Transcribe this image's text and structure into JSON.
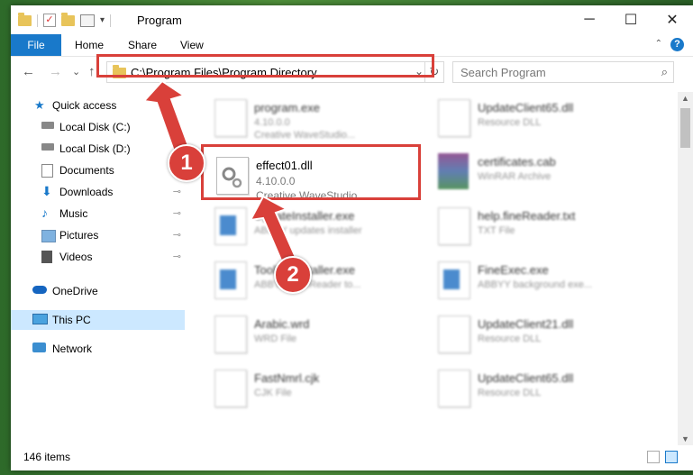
{
  "window": {
    "title": "Program",
    "minimize_glyph": "─",
    "maximize_glyph": "☐",
    "close_glyph": "✕"
  },
  "ribbon": {
    "tabs": [
      "File",
      "Home",
      "Share",
      "View"
    ],
    "help_glyph": "?",
    "collapse_glyph": "⌃"
  },
  "navigation": {
    "back_glyph": "←",
    "forward_glyph": "→",
    "recent_glyph": "⌄",
    "up_glyph": "↑",
    "address": "C:\\Program Files\\Program Directory",
    "dropdown_glyph": "⌄",
    "refresh_glyph": "↻",
    "search_placeholder": "Search Program",
    "search_glyph": "⌕"
  },
  "sidebar": {
    "items": [
      {
        "label": "Quick access",
        "icon": "star-icon"
      },
      {
        "label": "Local Disk (C:)",
        "icon": "drive-icon"
      },
      {
        "label": "Local Disk (D:)",
        "icon": "drive-icon"
      },
      {
        "label": "Documents",
        "icon": "documents-icon"
      },
      {
        "label": "Downloads",
        "icon": "download-icon",
        "pinned": true
      },
      {
        "label": "Music",
        "icon": "music-icon",
        "pinned": true
      },
      {
        "label": "Pictures",
        "icon": "pictures-icon",
        "pinned": true
      },
      {
        "label": "Videos",
        "icon": "videos-icon",
        "pinned": true
      },
      {
        "label": "OneDrive",
        "icon": "cloud-icon"
      },
      {
        "label": "This PC",
        "icon": "computer-icon",
        "selected": true
      },
      {
        "label": "Network",
        "icon": "network-icon"
      }
    ],
    "pin_glyph": "📌"
  },
  "files": [
    {
      "name": "program.exe",
      "line1": "4.10.0.0",
      "line2": "Creative WaveStudio...",
      "blurred": true
    },
    {
      "name": "UpdateClient65.dll",
      "line1": "Resource DLL",
      "blurred": true
    },
    {
      "name": "effect01.dll",
      "line1": "4.10.0.0",
      "line2": "Creative WaveStudio...",
      "blurred": false
    },
    {
      "name": "certificates.cab",
      "line1": "WinRAR Archive",
      "blurred": true
    },
    {
      "name": "UpdateInstaller.exe",
      "line1": "ABBYY updates installer",
      "blurred": true
    },
    {
      "name": "help.fineReader.txt",
      "line1": "TXT File",
      "blurred": true
    },
    {
      "name": "ToolbarInstaller.exe",
      "line1": "ABBYY FineReader to...",
      "blurred": true
    },
    {
      "name": "FineExec.exe",
      "line1": "ABBYY background exe...",
      "blurred": true
    },
    {
      "name": "Arabic.wrd",
      "line1": "WRD File",
      "blurred": true
    },
    {
      "name": "UpdateClient21.dll",
      "line1": "Resource DLL",
      "blurred": true
    },
    {
      "name": "FastNmrl.cjk",
      "line1": "CJK File",
      "blurred": true
    },
    {
      "name": "UpdateClient65.dll",
      "line1": "Resource DLL",
      "blurred": true
    }
  ],
  "status": {
    "item_count": "146 items"
  },
  "callouts": [
    "1",
    "2"
  ],
  "colors": {
    "accent": "#1979ca",
    "annotation": "#d9403a",
    "selected": "#cce8ff"
  }
}
